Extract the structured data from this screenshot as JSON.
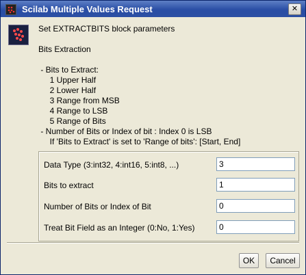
{
  "window": {
    "title": "Scilab Multiple Values Request"
  },
  "header": "Set EXTRACTBITS block parameters",
  "description": [
    "Bits Extraction",
    "",
    " - Bits to Extract:",
    "     1 Upper Half",
    "     2 Lower Half",
    "     3 Range from MSB",
    "     4 Range to LSB",
    "     5 Range of Bits",
    " - Number of Bits or Index of bit : Index 0 is LSB",
    "     If 'Bits to Extract' is set to 'Range of bits': [Start, End]"
  ],
  "fields": [
    {
      "label": "Data Type (3:int32, 4:int16, 5:int8, ...)",
      "value": "3"
    },
    {
      "label": "Bits to extract",
      "value": "1"
    },
    {
      "label": "Number of Bits or Index of Bit",
      "value": "0"
    },
    {
      "label": "Treat Bit Field as an Integer (0:No, 1:Yes)",
      "value": "0"
    }
  ],
  "buttons": {
    "ok": "OK",
    "cancel": "Cancel"
  },
  "icons": {
    "close": "✕"
  }
}
